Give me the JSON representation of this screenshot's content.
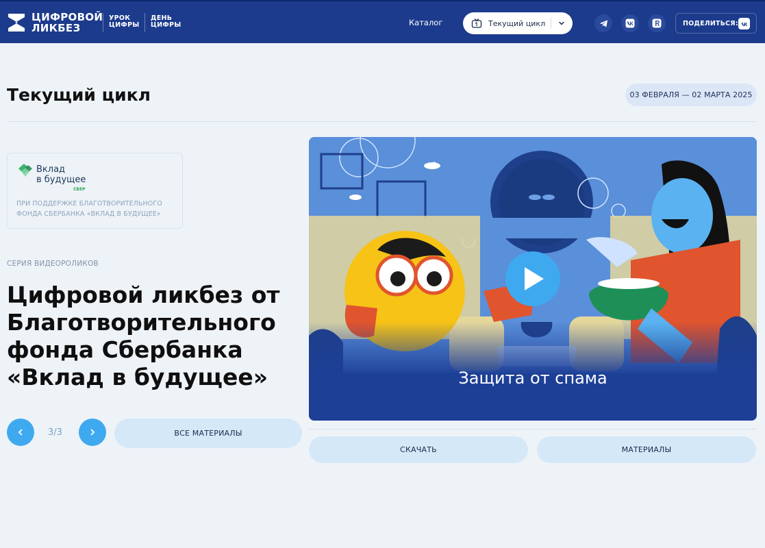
{
  "header": {
    "logo_line1": "ЦИФРОВОЙ",
    "logo_line2": "ЛИКБЕЗ",
    "urok_line1": "УРОК",
    "urok_line2": "ЦИФРЫ",
    "den_line1": "ДЕНЬ",
    "den_line2": "ЦИФРЫ",
    "catalog": "Каталог",
    "cycle_select": "Текущий цикл",
    "social": [
      "telegram-icon",
      "vk-icon",
      "yandex-icon"
    ],
    "share_label": "ПОДЕЛИТЬСЯ:"
  },
  "page": {
    "title": "Текущий цикл",
    "dates": "03 ФЕВРАЛЯ — 02 МАРТА 2025"
  },
  "sponsor": {
    "name_line1": "Вклад",
    "name_line2": "в будущее",
    "sber": "СБЕР",
    "text": "ПРИ ПОДДЕРЖКЕ БЛАГОТВОРИТЕЛЬНОГО ФОНДА СБЕРБАНКА «ВКЛАД В БУДУЩЕЕ»"
  },
  "series": {
    "label": "СЕРИЯ ВИДЕОРОЛИКОВ",
    "heading": "Цифровой ликбез от Благотворительного фонда Сбербанка «Вклад в будущее»"
  },
  "pager": {
    "count": "3/3",
    "all_materials": "ВСЕ МАТЕРИАЛЫ"
  },
  "video": {
    "title": "Защита от спама",
    "download": "СКАЧАТЬ",
    "materials": "МАТЕРИАЛЫ"
  },
  "colors": {
    "header_bg": "#1c3b8c",
    "accent_blue": "#3fa9f0",
    "pill_bg": "#d5e8f8",
    "page_bg": "#eef3f8"
  }
}
